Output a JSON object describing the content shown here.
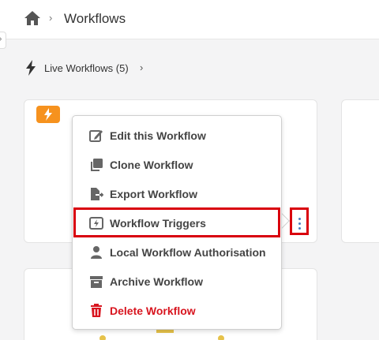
{
  "header": {
    "title": "Workflows"
  },
  "subheader": {
    "live_label": "Live Workflows (5)"
  },
  "menu": {
    "items": [
      {
        "label": "Edit this Workflow",
        "icon": "edit-icon"
      },
      {
        "label": "Clone Workflow",
        "icon": "clone-icon"
      },
      {
        "label": "Export Workflow",
        "icon": "export-icon"
      },
      {
        "label": "Workflow Triggers",
        "icon": "lightning-icon"
      },
      {
        "label": "Local Workflow Authorisation",
        "icon": "user-icon"
      },
      {
        "label": "Archive Workflow",
        "icon": "archive-icon"
      },
      {
        "label": "Delete Workflow",
        "icon": "trash-icon"
      }
    ]
  },
  "colors": {
    "accent_orange": "#f6921e",
    "highlight_red": "#d9000d",
    "danger_red": "#d8151f",
    "icon_gray": "#666666",
    "kebab_blue": "#4a7fc1"
  }
}
